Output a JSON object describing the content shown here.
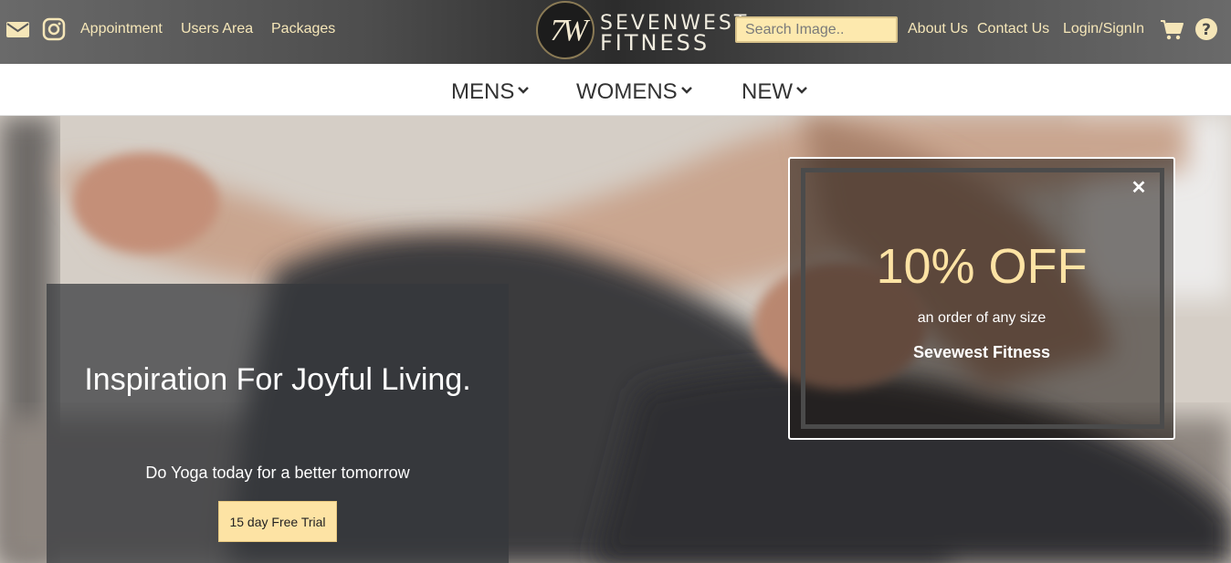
{
  "header": {
    "left_links": [
      "Appointment",
      "Users Area",
      "Packages"
    ],
    "logo": {
      "monogram": "7W",
      "line1": "SEVENWEST",
      "line2": "FITNESS"
    },
    "search": {
      "placeholder": "Search Image.."
    },
    "right_links": [
      "About Us",
      "Contact Us",
      "Login/SignIn"
    ],
    "icons": [
      "mail-icon",
      "instagram-icon",
      "cart-icon",
      "help-icon"
    ]
  },
  "nav": {
    "items": [
      "MENS",
      "WOMENS",
      "NEW"
    ]
  },
  "hero": {
    "title": "Inspiration For Joyful Living.",
    "subtitle": "Do Yoga today for a better tomorrow",
    "cta": "15 day Free Trial"
  },
  "promo": {
    "close": "✕",
    "title": "10% OFF",
    "subtitle": "an order of any size",
    "brand": "Sevewest Fitness"
  },
  "colors": {
    "accent": "#fde3a4",
    "link": "#f5e6b8",
    "nav_text": "#333333"
  }
}
